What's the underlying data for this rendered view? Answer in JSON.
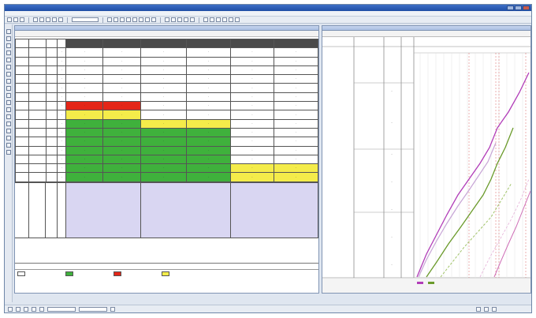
{
  "window": {
    "title": ""
  },
  "menu": [
    "",
    "",
    "",
    "",
    "",
    ""
  ],
  "left_pane": {
    "title": "",
    "header_left": "",
    "header_center": "",
    "header_right": "",
    "rows": [
      [
        "",
        "",
        "",
        "",
        "",
        "",
        "",
        ""
      ],
      [
        "·",
        "·",
        "·",
        "·",
        "·",
        "·",
        "·",
        ""
      ],
      [
        "·",
        "·",
        "·",
        "·",
        "·",
        "·",
        "·",
        ""
      ],
      [
        "·",
        "·",
        "·",
        "·",
        "·",
        "·",
        "·",
        ""
      ],
      [
        "·",
        "·",
        "·",
        "·",
        "·",
        "·",
        "·",
        ""
      ],
      [
        "·",
        "·",
        "·",
        "·",
        "·",
        "·",
        "·",
        ""
      ],
      [
        "·",
        "·",
        "·",
        "·",
        "·",
        "·",
        "·",
        ""
      ],
      [
        "·",
        "·",
        "·",
        "·",
        "·",
        "·",
        "·",
        ""
      ],
      [
        "·",
        "·",
        "·",
        "·",
        "·",
        "·",
        "·",
        ""
      ],
      [
        "·",
        "·",
        "·",
        "·",
        "·",
        "·",
        "·",
        ""
      ],
      [
        "·",
        "·",
        "·",
        "·",
        "·",
        "·",
        "·",
        ""
      ],
      [
        "·",
        "·",
        "·",
        "·",
        "·",
        "·",
        "·",
        ""
      ],
      [
        "·",
        "·",
        "·",
        "·",
        "·",
        "·",
        "·",
        ""
      ],
      [
        "·",
        "·",
        "·",
        "·",
        "·",
        "·",
        "·",
        ""
      ],
      [
        "·",
        "·",
        "·",
        "·",
        "·",
        "·",
        "·",
        ""
      ],
      [
        "·",
        "·",
        "·",
        "·",
        "·",
        "·",
        "·",
        ""
      ]
    ],
    "legend_labels": [
      "",
      "",
      "",
      "",
      "",
      ""
    ]
  },
  "right_pane": {
    "title": "",
    "header_center": "",
    "header_right": ""
  },
  "colors": {
    "red": "#e42618",
    "yellow": "#f4ec4a",
    "green": "#3fb13c",
    "lavender": "#d9d6f2",
    "dark": "#4a4a4a",
    "magenta": "#b13cb8",
    "olive": "#6a9a2a"
  }
}
